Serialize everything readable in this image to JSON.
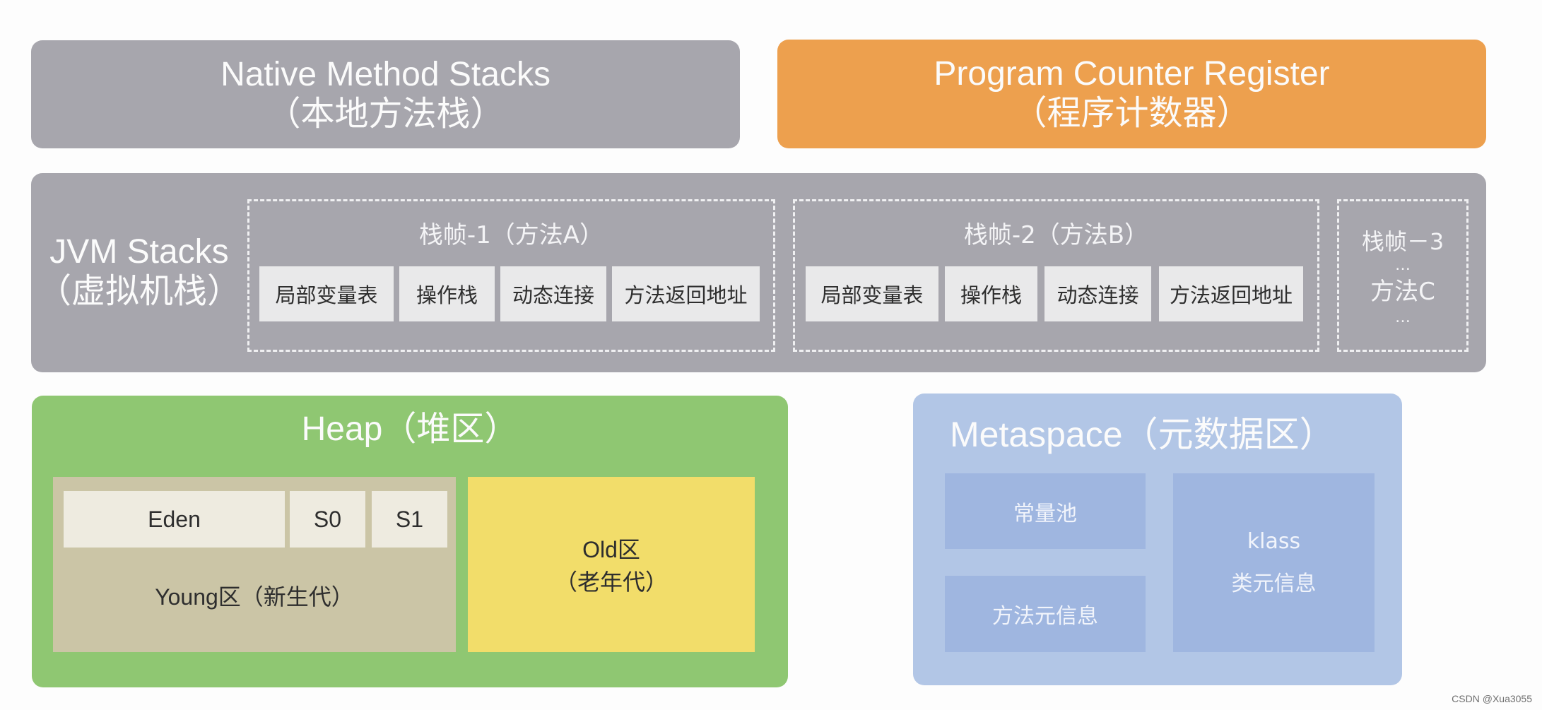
{
  "native_method_stacks": {
    "title_en": "Native Method Stacks",
    "title_cn": "（本地方法栈）",
    "color": "#a7a6ad"
  },
  "program_counter_register": {
    "title_en": "Program Counter Register",
    "title_cn": "（程序计数器）",
    "color": "#eda04e"
  },
  "jvm_stacks": {
    "title_en": "JVM Stacks",
    "title_cn": "（虚拟机栈）",
    "frames": [
      {
        "title": "栈帧-1（方法A）",
        "cells": [
          "局部变量表",
          "操作栈",
          "动态连接",
          "方法返回地址"
        ]
      },
      {
        "title": "栈帧-2（方法B）",
        "cells": [
          "局部变量表",
          "操作栈",
          "动态连接",
          "方法返回地址"
        ]
      },
      {
        "title": "栈帧－3",
        "ellipsis_top": "…",
        "method": "方法C",
        "ellipsis_bottom": "…"
      }
    ]
  },
  "heap": {
    "title": "Heap（堆区）",
    "color": "#8fc772",
    "young": {
      "eden": "Eden",
      "s0": "S0",
      "s1": "S1",
      "label": "Young区（新生代）"
    },
    "old": {
      "line1": "Old区",
      "line2": "（老年代）"
    }
  },
  "metaspace": {
    "title": "Metaspace（元数据区）",
    "color": "#b2c6e6",
    "constant_pool": "常量池",
    "method_meta": "方法元信息",
    "klass_line1": "klass",
    "klass_line2": "类元信息"
  },
  "watermark": "CSDN @Xua3055"
}
